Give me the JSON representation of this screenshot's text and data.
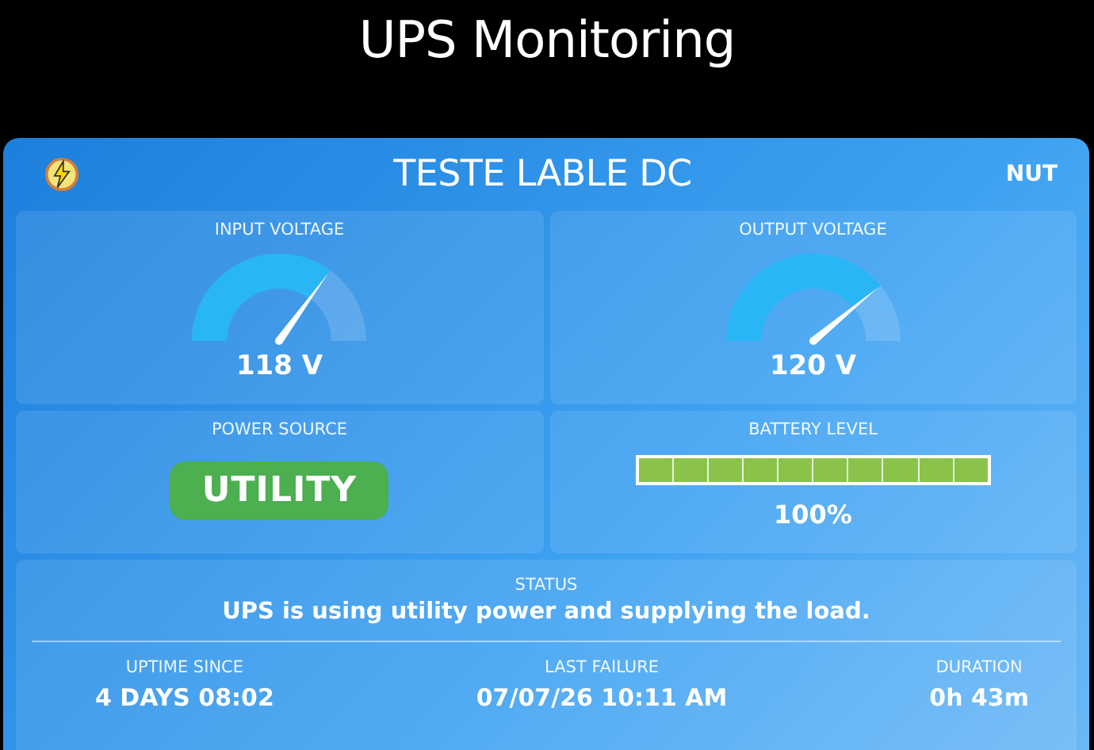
{
  "page_title": "UPS Monitoring",
  "device": {
    "name": "TESTE LABLE DC",
    "driver": "NUT"
  },
  "gauges": [
    {
      "label": "INPUT VOLTAGE",
      "reading": "118 V"
    },
    {
      "label": "OUTPUT VOLTAGE",
      "reading": "120 V"
    }
  ],
  "power_source": {
    "label": "POWER SOURCE",
    "value": "UTILITY",
    "kind": "utility"
  },
  "battery": {
    "label": "BATTERY LEVEL",
    "level": 1,
    "reading": "100%"
  },
  "status": {
    "label": "STATUS",
    "message": "UPS is using utility power and supplying the load.",
    "stats": [
      {
        "label": "UPTIME SINCE",
        "value": "4 DAYS 08:02"
      },
      {
        "label": "LAST FAILURE",
        "value": "07/07/26 10:11 AM"
      },
      {
        "label": "DURATION",
        "value": "0h 43m"
      }
    ]
  }
}
